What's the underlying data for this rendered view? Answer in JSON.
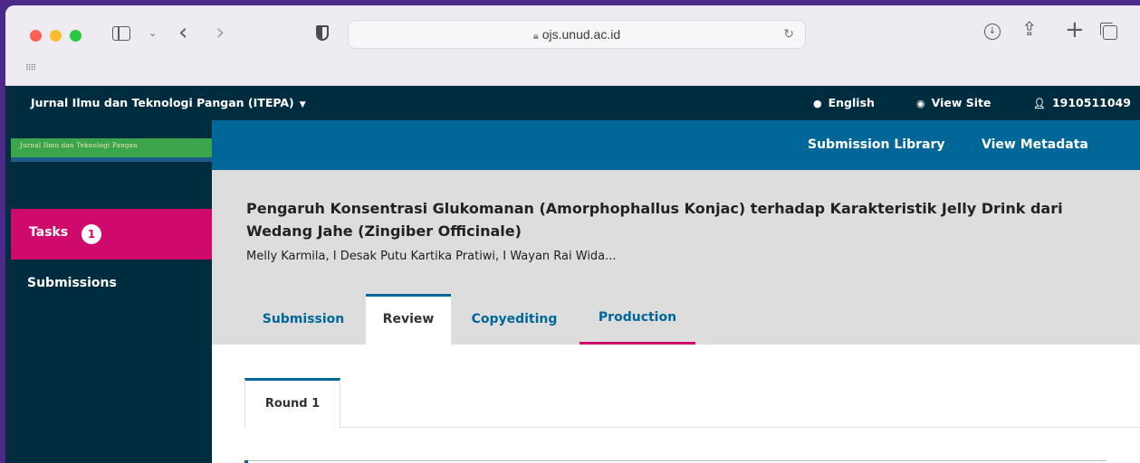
{
  "browser": {
    "url": "ojs.unud.ac.id",
    "icons": [
      "sidebar-toggle-icon",
      "chevron-down-icon",
      "back-icon",
      "forward-icon",
      "shield-icon",
      "lock-icon",
      "reload-icon",
      "download-icon",
      "share-icon",
      "new-tab-icon",
      "tabs-overview-icon",
      "apps-grid-icon"
    ]
  },
  "topbar": {
    "journal": "Jurnal Ilmu dan Teknologi Pangan (ITEPA)",
    "language": "English",
    "view_site": "View Site",
    "user": "1910511049"
  },
  "sidebar": {
    "logo_text": "Jurnal Ilmu dan Teknologi Pangan",
    "items": [
      {
        "label": "Tasks",
        "badge": "1",
        "active": true
      },
      {
        "label": "Submissions",
        "active": false
      }
    ]
  },
  "actions": {
    "library": "Submission Library",
    "metadata": "View Metadata"
  },
  "submission": {
    "title": "Pengaruh Konsentrasi Glukomanan (Amorphophallus Konjac) terhadap Karakteristik Jelly Drink dari Wedang Jahe (Zingiber Officinale)",
    "authors": "Melly Karmila, I Desak Putu Kartika Pratiwi, I Wayan Rai Wida..."
  },
  "stage_tabs": [
    {
      "label": "Submission"
    },
    {
      "label": "Review",
      "active": true
    },
    {
      "label": "Copyediting"
    },
    {
      "label": "Production"
    }
  ],
  "rounds": [
    {
      "label": "Round 1",
      "active": true
    }
  ],
  "colors": {
    "header_bg": "#002c40",
    "primary_blue": "#006798",
    "accent_pink": "#d00a6c",
    "summary_bg": "#dddddd"
  }
}
